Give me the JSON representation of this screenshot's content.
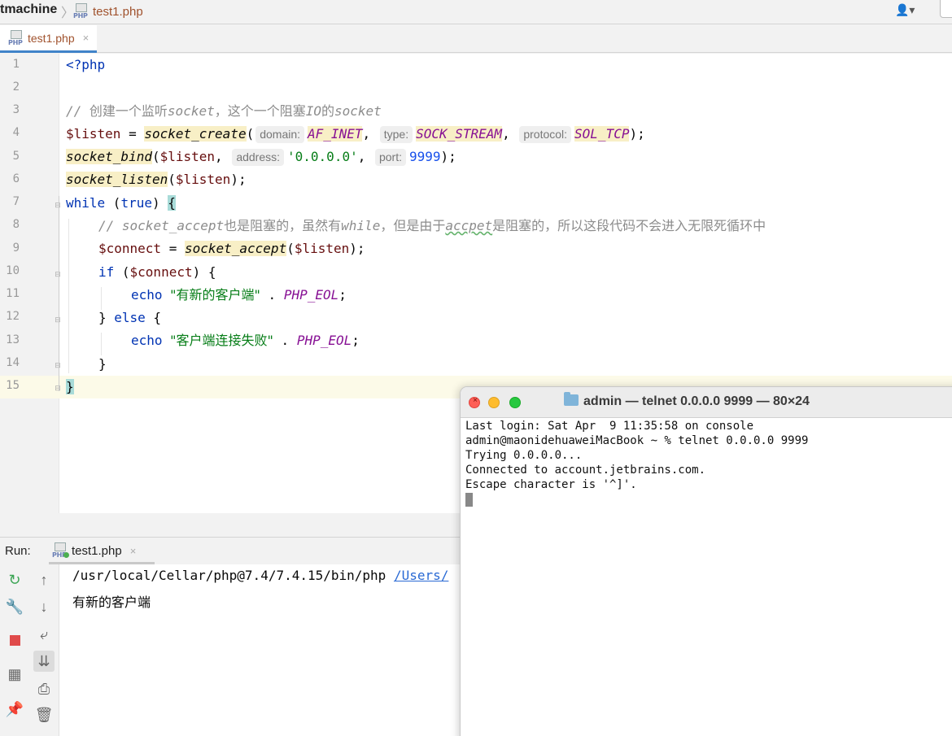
{
  "breadcrumb": {
    "root": "tmachine",
    "file": "test1.php"
  },
  "user_menu_glyph": "👤▾",
  "editor_tab": {
    "label": "test1.php",
    "close": "×"
  },
  "file_icon_text": "PHP",
  "line_numbers": [
    "1",
    "2",
    "3",
    "4",
    "5",
    "6",
    "7",
    "8",
    "9",
    "10",
    "11",
    "12",
    "13",
    "14",
    "15"
  ],
  "code": {
    "l1": "<?php",
    "l3": {
      "prefix": "// ",
      "c1": "创建一个监听",
      "c2": "socket",
      "c3": "，这个一个阻塞",
      "c4": "IO",
      "c5": "的",
      "c6": "socket"
    },
    "l4": {
      "var": "$listen",
      "eq": " = ",
      "fn": "socket_create",
      "open": "(",
      "h1": "domain:",
      "a1": "AF_INET",
      "sep1": ", ",
      "h2": "type:",
      "a2": "SOCK_STREAM",
      "sep2": ", ",
      "h3": "protocol:",
      "a3": "SOL_TCP",
      "close": ");"
    },
    "l5": {
      "fn": "socket_bind",
      "open": "(",
      "var": "$listen",
      "sep1": ", ",
      "h1": "address:",
      "a1": "'0.0.0.0'",
      "sep2": ", ",
      "h2": "port:",
      "a2": "9999",
      "close": ");"
    },
    "l6": {
      "fn": "socket_listen",
      "open": "(",
      "var": "$listen",
      "close": ");"
    },
    "l7": {
      "kw": "while",
      "mid": " (",
      "kw2": "true",
      "close": ") ",
      "brace": "{"
    },
    "l8": {
      "prefix": "// ",
      "c1": "socket_accept",
      "c2": "也是阻塞的，虽然有",
      "c3": "while",
      "c4": "，但是由于",
      "c5": "accpet",
      "c6": "是阻塞的，所以这段代码不会进入无限死循环中"
    },
    "l9": {
      "var": "$connect",
      "eq": " = ",
      "fn": "socket_accept",
      "open": "(",
      "var2": "$listen",
      "close": ");"
    },
    "l10": {
      "kw": "if",
      "open": " (",
      "var": "$connect",
      "close": ") {"
    },
    "l11": {
      "kw": "echo",
      "sp": " ",
      "str": "\"有新的客户端\"",
      "dot": " . ",
      "const": "PHP_EOL",
      "end": ";"
    },
    "l12": {
      "open": "} ",
      "kw": "else",
      "close": " {"
    },
    "l13": {
      "kw": "echo",
      "sp": " ",
      "str": "\"客户端连接失败\"",
      "dot": " . ",
      "const": "PHP_EOL",
      "end": ";"
    },
    "l14": "}",
    "l15": "}"
  },
  "run": {
    "label": "Run:",
    "tab": "test1.php",
    "close": "×",
    "cmd": "/usr/local/Cellar/php@7.4/7.4.15/bin/php ",
    "cmd_link": "/Users/",
    "output": "有新的客户端"
  },
  "terminal": {
    "title": "admin — telnet 0.0.0.0 9999 — 80×24",
    "lines": [
      "Last login: Sat Apr  9 11:35:58 on console",
      "admin@maonidehuaweiMacBook ~ % telnet 0.0.0.0 9999",
      "Trying 0.0.0.0...",
      "Connected to account.jetbrains.com.",
      "Escape character is '^]'."
    ]
  },
  "colors": {
    "keyword": "#0033b3",
    "string": "#067d17",
    "number": "#1750eb",
    "constant": "#871094",
    "variable": "#660e0e",
    "comment": "#8c8c8c",
    "tab_accent": "#4083c9"
  }
}
